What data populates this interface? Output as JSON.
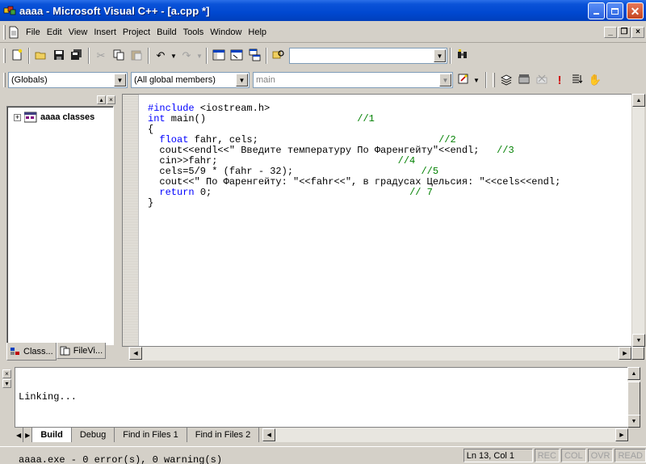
{
  "window": {
    "title": "aaaa - Microsoft Visual C++ - [a.cpp *]",
    "titlebar_color": "#0048d0",
    "buttons": [
      "minimize-icon",
      "restore-icon",
      "close-icon"
    ]
  },
  "menu": {
    "items": [
      "File",
      "Edit",
      "View",
      "Insert",
      "Project",
      "Build",
      "Tools",
      "Window",
      "Help"
    ],
    "mdi_buttons": [
      "_",
      "❐",
      "×"
    ]
  },
  "toolbar": {
    "find_value": ""
  },
  "wizardbar": {
    "scope": "(Globals)",
    "members": "(All global members)",
    "function": "main"
  },
  "workspace": {
    "tree_root": "aaaa classes",
    "tabs": [
      "Class...",
      "FileVi..."
    ]
  },
  "editor": {
    "lines": [
      {
        "parts": [
          {
            "t": "#include",
            "c": "kw"
          },
          {
            "t": " <iostream.h>",
            "c": ""
          }
        ]
      },
      {
        "parts": [
          {
            "t": "int",
            "c": "kw"
          },
          {
            "t": " main()                          ",
            "c": ""
          },
          {
            "t": "//1",
            "c": "cm"
          }
        ]
      },
      {
        "parts": [
          {
            "t": "{",
            "c": ""
          }
        ]
      },
      {
        "parts": [
          {
            "t": "  ",
            "c": ""
          },
          {
            "t": "float",
            "c": "kw"
          },
          {
            "t": " fahr, cels;                               ",
            "c": ""
          },
          {
            "t": "//2",
            "c": "cm"
          }
        ]
      },
      {
        "parts": [
          {
            "t": "  cout<<endl<<\" Введите температуру По Фаренгейту\"<<endl;   ",
            "c": ""
          },
          {
            "t": "//3",
            "c": "cm"
          }
        ]
      },
      {
        "parts": [
          {
            "t": "  cin>>fahr;                               ",
            "c": ""
          },
          {
            "t": "//4",
            "c": "cm"
          }
        ]
      },
      {
        "parts": [
          {
            "t": "  cels=5/9 * (fahr - 32);                      ",
            "c": ""
          },
          {
            "t": "//5",
            "c": "cm"
          }
        ]
      },
      {
        "parts": [
          {
            "t": "  cout<<\" По Фаренгейту: \"<<fahr<<\", в градусах Цельсия: \"<<cels<<endl;",
            "c": ""
          }
        ]
      },
      {
        "parts": [
          {
            "t": "  ",
            "c": ""
          },
          {
            "t": "return",
            "c": "kw"
          },
          {
            "t": " 0;                                  ",
            "c": ""
          },
          {
            "t": "// 7",
            "c": "cm"
          }
        ]
      },
      {
        "parts": [
          {
            "t": "}",
            "c": ""
          }
        ]
      }
    ]
  },
  "output": {
    "lines": [
      "Linking...",
      "",
      "aaaa.exe - 0 error(s), 0 warning(s)"
    ],
    "tabs": [
      "Build",
      "Debug",
      "Find in Files 1",
      "Find in Files 2"
    ],
    "active_tab": "Build"
  },
  "status": {
    "position": "Ln 13, Col 1",
    "indicators": [
      "REC",
      "COL",
      "OVR",
      "READ"
    ]
  }
}
